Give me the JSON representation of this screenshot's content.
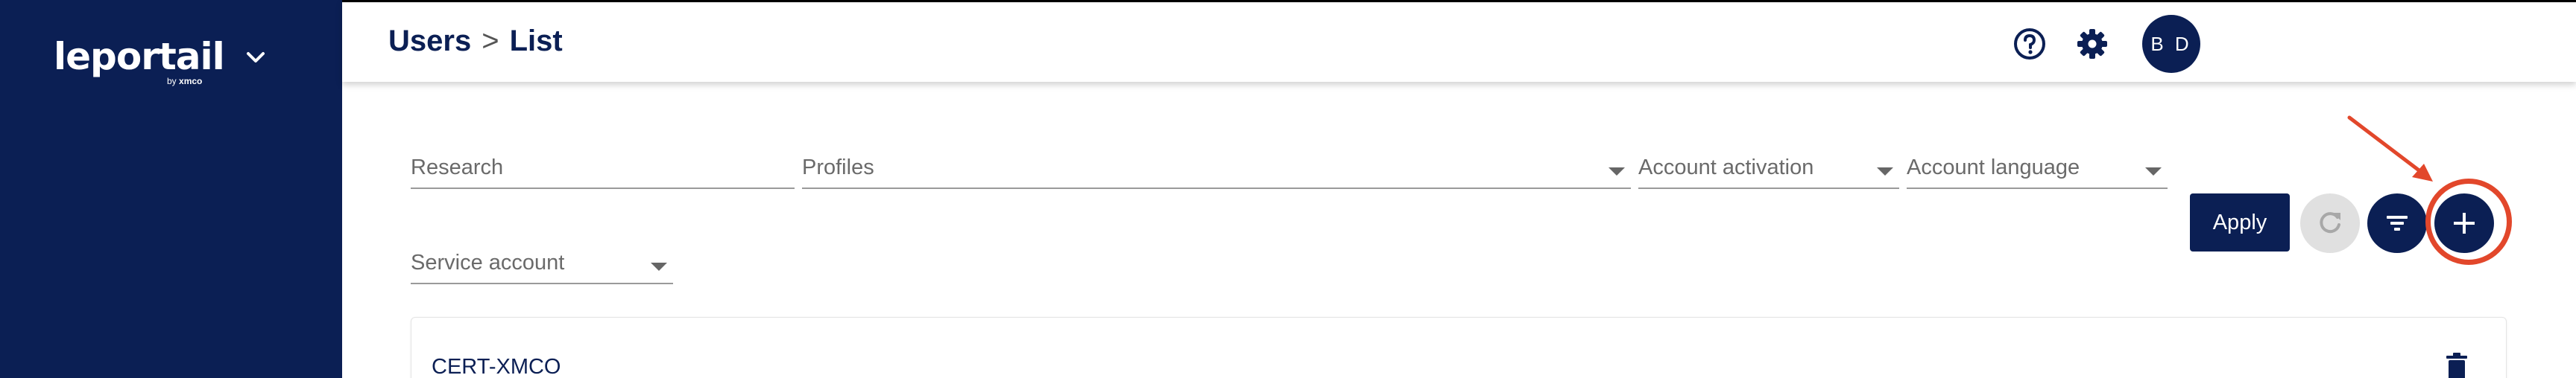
{
  "sidebar": {
    "logo_text": "leportail",
    "logo_sub_prefix": "by",
    "logo_sub_brand": "xmco",
    "toggle_icon": "chevron-down-icon"
  },
  "header": {
    "breadcrumb_section": "Users",
    "breadcrumb_separator": ">",
    "breadcrumb_page": "List",
    "help_icon": "help-circle-icon",
    "settings_icon": "gear-icon",
    "avatar_initials": "B D"
  },
  "filters": {
    "research_placeholder": "Research",
    "profiles_placeholder": "Profiles",
    "account_activation_placeholder": "Account activation",
    "account_language_placeholder": "Account language",
    "service_account_placeholder": "Service account"
  },
  "actions": {
    "apply_label": "Apply",
    "refresh_icon": "refresh-icon",
    "filter_icon": "filter-icon",
    "add_icon": "plus-icon"
  },
  "list": {
    "rows": [
      {
        "name": "CERT-XMCO",
        "action_icon": "trash-icon"
      }
    ]
  },
  "colors": {
    "primary": "#0b1f54",
    "highlight": "#e2472b",
    "disabled": "#e0e0e0"
  }
}
